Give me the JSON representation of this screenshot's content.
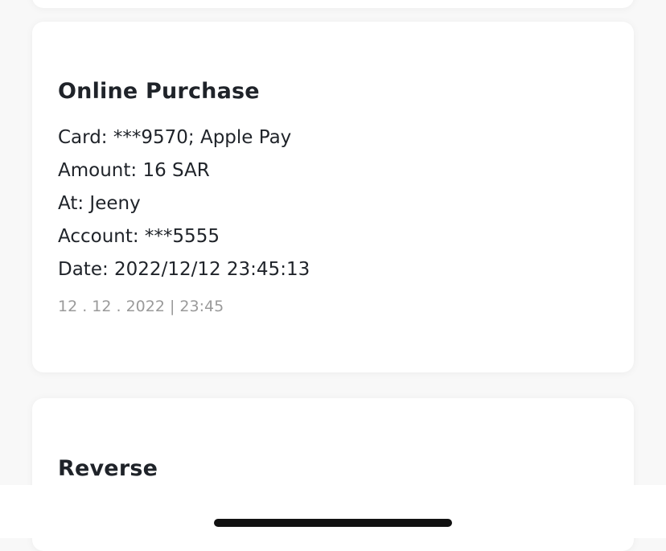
{
  "transactions": [
    {
      "title": "Online Purchase",
      "lines": [
        "Card: ***9570; Apple Pay",
        "Amount: 16 SAR",
        "At: Jeeny",
        "Account: ***5555",
        "Date: 2022/12/12 23:45:13"
      ],
      "timestamp": "12 . 12 . 2022 | 23:45"
    },
    {
      "title": "Reverse"
    }
  ]
}
